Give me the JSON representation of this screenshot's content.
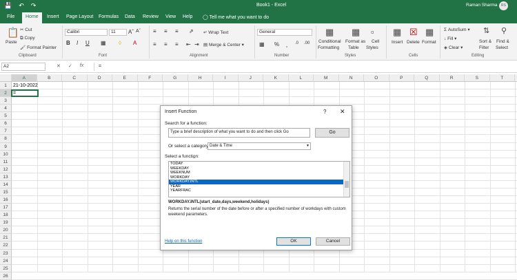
{
  "titlebar": {
    "title": "Book1 - Excel",
    "user": "Raman Sharma",
    "initials": "RS"
  },
  "tabs": [
    "File",
    "Home",
    "Insert",
    "Page Layout",
    "Formulas",
    "Data",
    "Review",
    "View",
    "Help"
  ],
  "tell_me": "Tell me what you want to do",
  "ribbon": {
    "clipboard": {
      "paste": "Paste",
      "cut": "Cut",
      "copy": "Copy",
      "format_painter": "Format Painter",
      "group": "Clipboard"
    },
    "font": {
      "name": "Calibri",
      "size": "11",
      "group": "Font"
    },
    "alignment": {
      "wrap": "Wrap Text",
      "merge": "Merge & Center",
      "group": "Alignment"
    },
    "number": {
      "format": "General",
      "group": "Number"
    },
    "styles": {
      "conditional": "Conditional",
      "conditional2": "Formatting",
      "format_as": "Format as",
      "table": "Table",
      "cell": "Cell",
      "styles": "Styles",
      "group": "Styles"
    },
    "cells": {
      "insert": "Insert",
      "delete": "Delete",
      "format": "Format",
      "group": "Cells"
    },
    "editing": {
      "autosum": "AutoSum",
      "fill": "Fill",
      "clear": "Clear",
      "sort": "Sort &",
      "filter": "Filter",
      "find": "Find &",
      "select": "Select",
      "group": "Editing"
    }
  },
  "formula_bar": {
    "name_box": "A2",
    "content": "="
  },
  "columns": [
    "A",
    "B",
    "C",
    "D",
    "E",
    "F",
    "G",
    "H",
    "I",
    "J",
    "K",
    "L",
    "M",
    "N",
    "O",
    "P",
    "Q",
    "R",
    "S",
    "T",
    "U"
  ],
  "rows": [
    "1",
    "2",
    "3",
    "4",
    "5",
    "6",
    "7",
    "8",
    "9",
    "10",
    "11",
    "12",
    "13",
    "14",
    "15",
    "16",
    "17",
    "18",
    "19",
    "20",
    "21",
    "22",
    "23",
    "24",
    "25",
    "26"
  ],
  "cells": {
    "a1": "21-10-2022",
    "a2": "="
  },
  "dialog": {
    "title": "Insert Function",
    "help": "?",
    "search_label": "Search for a function:",
    "search_value": "Type a brief description of what you want to do and then click Go",
    "go": "Go",
    "category_label": "Or select a category:",
    "category_value": "Date & Time",
    "select_label": "Select a functio̲n:",
    "functions": [
      "TODAY",
      "WEEKDAY",
      "WEEKNUM",
      "WORKDAY",
      "WORKDAY.INTL",
      "YEAR",
      "YEARFRAC"
    ],
    "selected_index": 4,
    "signature": "WORKDAY.INTL(start_date,days,weekend,holidays)",
    "description": "Returns the serial number of the date before or after a specified number of workdays with custom weekend parameters.",
    "help_link": "Help on this function",
    "ok": "OK",
    "cancel": "Cancel"
  }
}
